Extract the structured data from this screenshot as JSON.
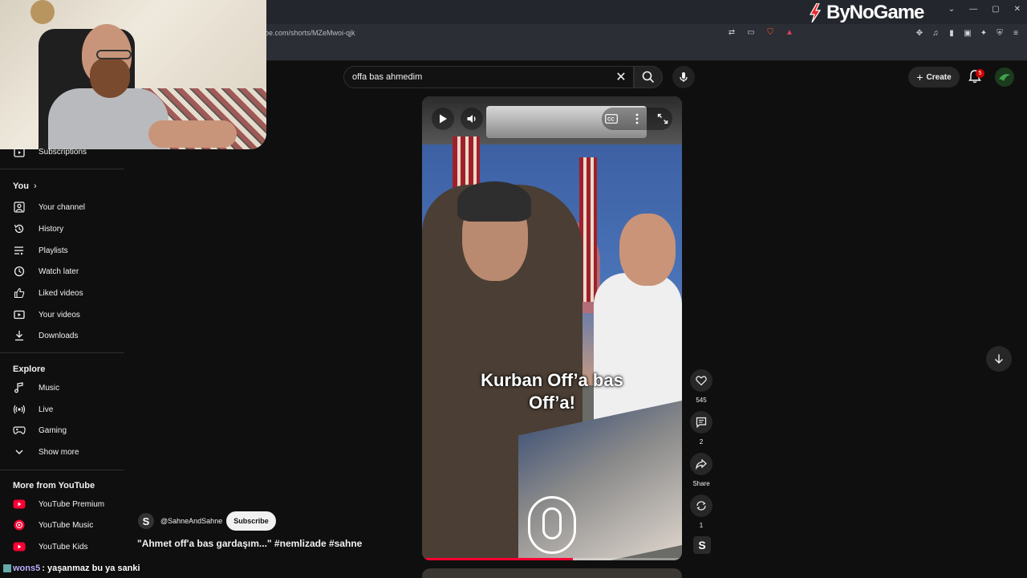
{
  "browser": {
    "url": "be.com/shorts/MZeMwoi-qjk",
    "overlay_brand": "ByNoGame",
    "window_buttons": [
      "⌄",
      "—",
      "▢",
      "✕"
    ]
  },
  "header": {
    "search_value": "offa bas ahmedim",
    "create_label": "Create",
    "notification_count": "5"
  },
  "sidebar": {
    "subscriptions_label": "Subscriptions",
    "you_heading": "You",
    "you_items": [
      {
        "label": "Your channel",
        "icon": "person-icon"
      },
      {
        "label": "History",
        "icon": "history-icon"
      },
      {
        "label": "Playlists",
        "icon": "playlist-icon"
      },
      {
        "label": "Watch later",
        "icon": "clock-icon"
      },
      {
        "label": "Liked videos",
        "icon": "thumbs-up-icon"
      },
      {
        "label": "Your videos",
        "icon": "video-icon"
      },
      {
        "label": "Downloads",
        "icon": "download-icon"
      }
    ],
    "explore_heading": "Explore",
    "explore_items": [
      {
        "label": "Music",
        "icon": "music-note-icon"
      },
      {
        "label": "Live",
        "icon": "live-icon"
      },
      {
        "label": "Gaming",
        "icon": "gamepad-icon"
      },
      {
        "label": "Show more",
        "icon": "chevron-down-icon"
      }
    ],
    "more_heading": "More from YouTube",
    "more_items": [
      {
        "label": "YouTube Premium",
        "icon": "yt-premium-icon"
      },
      {
        "label": "YouTube Music",
        "icon": "yt-music-icon"
      },
      {
        "label": "YouTube Kids",
        "icon": "yt-kids-icon"
      }
    ]
  },
  "video": {
    "caption_line1": "Kurban Off’a bas",
    "caption_line2": "Off’a!",
    "progress_fraction": 0.58
  },
  "actions": {
    "likes": "545",
    "comments": "2",
    "share_label": "Share",
    "remix_count": "1"
  },
  "channel": {
    "handle": "@SahneAndSahne",
    "subscribe_label": "Subscribe",
    "title": "\"Ahmet off'a bas gardaşım...\" #nemlizade #sahne"
  },
  "chat": {
    "user": "wons5",
    "message": ": yaşanmaz bu ya sanki"
  },
  "colors": {
    "background": "#0f0f0f",
    "accent_red": "#ff0033",
    "subscribe_bg": "#f1f1f1"
  }
}
